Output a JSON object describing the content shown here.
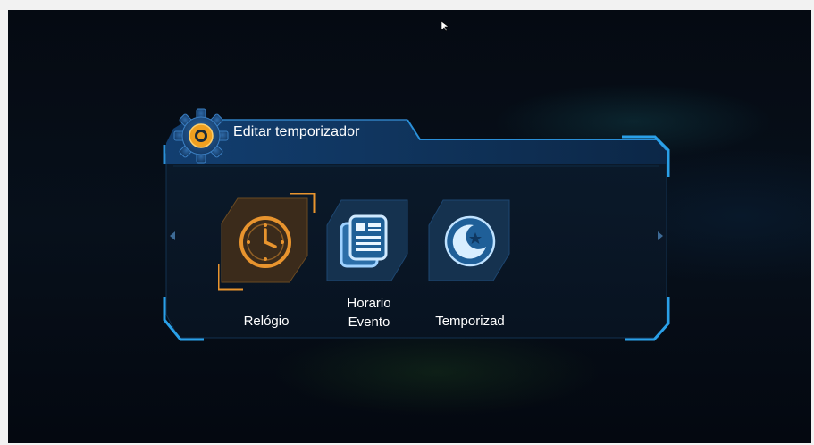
{
  "dialog": {
    "title": "Editar temporizador"
  },
  "menu": {
    "items": [
      {
        "label": "Relógio",
        "icon": "clock-icon",
        "selected": true
      },
      {
        "label_line1": "Horario",
        "label_line2": "Evento",
        "icon": "news-icon",
        "selected": false
      },
      {
        "label": "Temporizad",
        "icon": "moon-star-icon",
        "selected": false
      }
    ]
  },
  "colors": {
    "accent_orange": "#e8942e",
    "accent_blue": "#1f8fd8",
    "tile_blue": "#1b3b5e",
    "tile_selected": "#3a2a1a"
  }
}
